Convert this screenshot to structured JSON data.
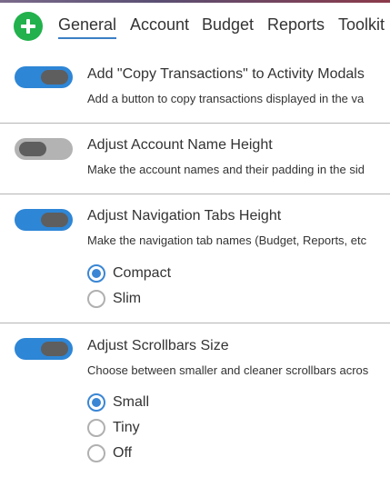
{
  "tabs": [
    {
      "label": "General"
    },
    {
      "label": "Account"
    },
    {
      "label": "Budget"
    },
    {
      "label": "Reports"
    },
    {
      "label": "Toolkit I"
    }
  ],
  "settings": [
    {
      "title": "Add \"Copy Transactions\" to Activity Modals",
      "description": "Add a button to copy transactions displayed in the va",
      "enabled": true
    },
    {
      "title": "Adjust Account Name Height",
      "description": "Make the account names and their padding in the sid",
      "enabled": false
    },
    {
      "title": "Adjust Navigation Tabs Height",
      "description": "Make the navigation tab names (Budget, Reports, etc",
      "enabled": true,
      "options": [
        {
          "label": "Compact",
          "checked": true
        },
        {
          "label": "Slim",
          "checked": false
        }
      ]
    },
    {
      "title": "Adjust Scrollbars Size",
      "description": "Choose between smaller and cleaner scrollbars acros",
      "enabled": true,
      "options": [
        {
          "label": "Small",
          "checked": true
        },
        {
          "label": "Tiny",
          "checked": false
        },
        {
          "label": "Off",
          "checked": false
        }
      ]
    }
  ],
  "colors": {
    "accent": "#2e86d6",
    "add_button": "#22b14c",
    "toggle_off": "#b3b3b3"
  }
}
